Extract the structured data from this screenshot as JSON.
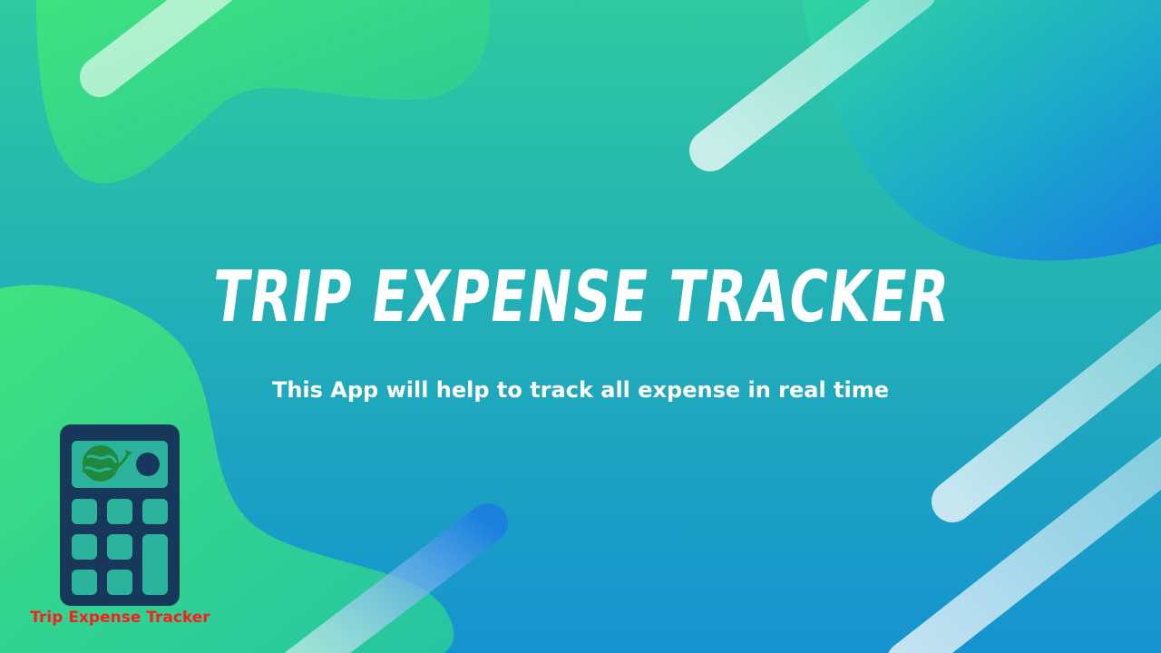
{
  "banner": {
    "title": "TRIP EXPENSE TRACKER",
    "subtitle": "This App will help to track all expense in real time"
  },
  "logo": {
    "caption": "Trip Expense Tracker",
    "icon": "calculator-globe-icon"
  },
  "colors": {
    "gradient_top": "#2ec9a0",
    "gradient_bottom": "#1593d0",
    "blob_green": "#3ee27e",
    "blob_blue": "#1a7ee0",
    "calculator_body": "#17375b",
    "calculator_keys": "#2bb39c",
    "globe": "#1f8a3b",
    "caption_red": "#ff1c1c"
  }
}
